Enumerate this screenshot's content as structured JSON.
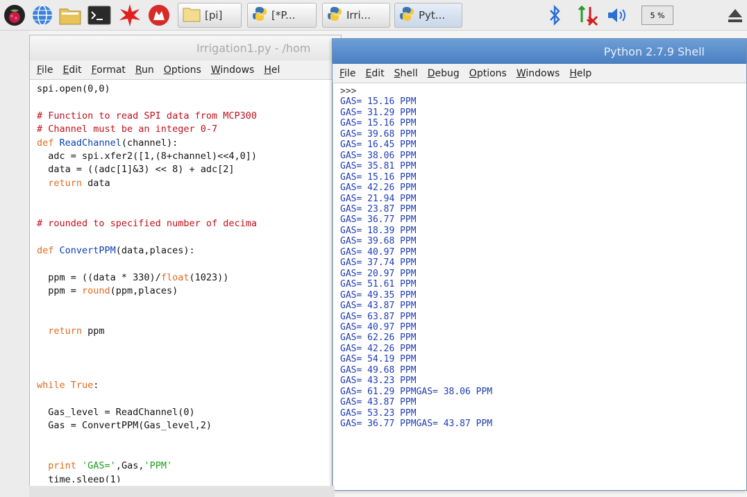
{
  "taskbar": {
    "launchers": [
      {
        "name": "raspberry-menu-icon"
      },
      {
        "name": "web-browser-icon"
      },
      {
        "name": "file-manager-icon"
      },
      {
        "name": "terminal-icon"
      },
      {
        "name": "math-kernel-icon"
      },
      {
        "name": "wolfram-icon"
      }
    ],
    "tasks": [
      {
        "label": "[pi]",
        "icon": "folder-icon"
      },
      {
        "label": "[*P...",
        "icon": "python-icon"
      },
      {
        "label": "Irri...",
        "icon": "python-icon"
      },
      {
        "label": "Pyt...",
        "icon": "python-icon"
      }
    ],
    "cpu_label": "5 %",
    "tray": {
      "bluetooth": "bluetooth-icon",
      "network": "network-icon",
      "volume": "volume-icon",
      "eject": "eject-icon"
    }
  },
  "editor": {
    "title": "Irrigation1.py - /hom",
    "menu": [
      "File",
      "Edit",
      "Format",
      "Run",
      "Options",
      "Windows",
      "Hel"
    ]
  },
  "shell": {
    "title": "Python 2.7.9 Shell",
    "menu": [
      "File",
      "Edit",
      "Shell",
      "Debug",
      "Options",
      "Windows",
      "Help"
    ],
    "prompt": ">>>",
    "lines": [
      "GAS= 15.16 PPM",
      "GAS= 31.29 PPM",
      "GAS= 15.16 PPM",
      "GAS= 39.68 PPM",
      "GAS= 16.45 PPM",
      "GAS= 38.06 PPM",
      "GAS= 35.81 PPM",
      "GAS= 15.16 PPM",
      "GAS= 42.26 PPM",
      "GAS= 21.94 PPM",
      "GAS= 23.87 PPM",
      "GAS= 36.77 PPM",
      "GAS= 18.39 PPM",
      "GAS= 39.68 PPM",
      "GAS= 40.97 PPM",
      "GAS= 37.74 PPM",
      "GAS= 20.97 PPM",
      "GAS= 51.61 PPM",
      "GAS= 49.35 PPM",
      "GAS= 43.87 PPM",
      "GAS= 63.87 PPM",
      "GAS= 40.97 PPM",
      "GAS= 62.26 PPM",
      "GAS= 42.26 PPM",
      "GAS= 54.19 PPM",
      "GAS= 49.68 PPM",
      "GAS= 43.23 PPM",
      "GAS= 61.29 PPMGAS= 38.06 PPM",
      "GAS= 43.87 PPM",
      "GAS= 53.23 PPM",
      "GAS= 36.77 PPMGAS= 43.87 PPM"
    ]
  },
  "code_lines": [
    [
      {
        "t": "spi.open(0,0)",
        "c": "pl"
      }
    ],
    [],
    [
      {
        "t": "# Function to read SPI data from MCP300",
        "c": "cm"
      }
    ],
    [
      {
        "t": "# Channel must be an integer 0-7",
        "c": "cm"
      }
    ],
    [
      {
        "t": "def ",
        "c": "kw"
      },
      {
        "t": "ReadChannel",
        "c": "fn"
      },
      {
        "t": "(channel):",
        "c": "pl"
      }
    ],
    [
      {
        "t": "  adc = spi.xfer2([1,(8+channel)<<4,0])",
        "c": "pl"
      }
    ],
    [
      {
        "t": "  data = ((adc[1]&3) << 8) + adc[2]",
        "c": "pl"
      }
    ],
    [
      {
        "t": "  ",
        "c": "pl"
      },
      {
        "t": "return",
        "c": "kw"
      },
      {
        "t": " data",
        "c": "pl"
      }
    ],
    [],
    [],
    [
      {
        "t": "# rounded to specified number of decima",
        "c": "cm"
      }
    ],
    [],
    [
      {
        "t": "def ",
        "c": "kw"
      },
      {
        "t": "ConvertPPM",
        "c": "fn"
      },
      {
        "t": "(data,places):",
        "c": "pl"
      }
    ],
    [],
    [
      {
        "t": "  ppm = ((data * 330)/",
        "c": "pl"
      },
      {
        "t": "float",
        "c": "kw"
      },
      {
        "t": "(1023))",
        "c": "pl"
      }
    ],
    [
      {
        "t": "  ppm = ",
        "c": "pl"
      },
      {
        "t": "round",
        "c": "kw"
      },
      {
        "t": "(ppm,places)",
        "c": "pl"
      }
    ],
    [],
    [],
    [
      {
        "t": "  ",
        "c": "pl"
      },
      {
        "t": "return",
        "c": "kw"
      },
      {
        "t": " ppm",
        "c": "pl"
      }
    ],
    [],
    [],
    [],
    [
      {
        "t": "while",
        "c": "kw"
      },
      {
        "t": " ",
        "c": "pl"
      },
      {
        "t": "True",
        "c": "kw"
      },
      {
        "t": ":",
        "c": "pl"
      }
    ],
    [],
    [
      {
        "t": "  Gas_level = ReadChannel(0)",
        "c": "pl"
      }
    ],
    [
      {
        "t": "  Gas = ConvertPPM(Gas_level,2)",
        "c": "pl"
      }
    ],
    [],
    [],
    [
      {
        "t": "  ",
        "c": "pl"
      },
      {
        "t": "print",
        "c": "kw"
      },
      {
        "t": " ",
        "c": "pl"
      },
      {
        "t": "'GAS='",
        "c": "st"
      },
      {
        "t": ",Gas,",
        "c": "pl"
      },
      {
        "t": "'PPM'",
        "c": "st"
      }
    ],
    [
      {
        "t": "  time.sleep(1)",
        "c": "pl"
      }
    ]
  ]
}
